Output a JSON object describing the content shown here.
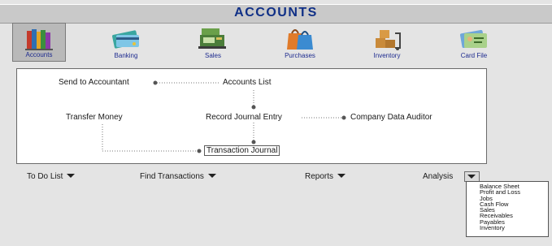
{
  "window": {
    "title": "ACCOUNTS"
  },
  "modules": [
    {
      "label": "Accounts",
      "icon": "accounts-books-icon",
      "active": true
    },
    {
      "label": "Banking",
      "icon": "banking-card-icon"
    },
    {
      "label": "Sales",
      "icon": "sales-register-icon"
    },
    {
      "label": "Purchases",
      "icon": "purchases-bags-icon"
    },
    {
      "label": "Inventory",
      "icon": "inventory-boxes-icon"
    },
    {
      "label": "Card File",
      "icon": "card-file-icon"
    }
  ],
  "flow": {
    "send_to_accountant": "Send to Accountant",
    "accounts_list": "Accounts List",
    "transfer_money": "Transfer Money",
    "record_journal_entry": "Record Journal Entry",
    "company_data_auditor": "Company Data Auditor",
    "transaction_journal": "Transaction Journal"
  },
  "bottom_bar": {
    "to_do_list": "To Do List",
    "find_transactions": "Find Transactions",
    "reports": "Reports",
    "analysis": "Analysis"
  },
  "analysis_menu": [
    "Balance Sheet",
    "Profit and Loss",
    "Jobs",
    "Cash Flow",
    "Sales",
    "Receivables",
    "Payables",
    "Inventory"
  ]
}
